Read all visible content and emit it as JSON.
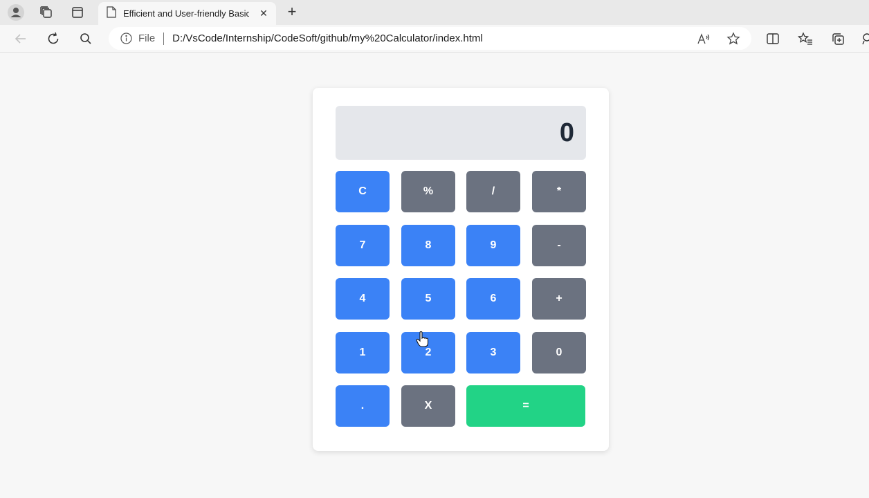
{
  "browser": {
    "tab_title": "Efficient and User-friendly Basic Calculator",
    "url_scheme_label": "File",
    "url": "D:/VsCode/Internship/CodeSoft/github/my%20Calculator/index.html"
  },
  "calculator": {
    "display_value": "0",
    "keys": {
      "clear": "C",
      "percent": "%",
      "divide": "/",
      "multiply": "*",
      "seven": "7",
      "eight": "8",
      "nine": "9",
      "minus": "-",
      "four": "4",
      "five": "5",
      "six": "6",
      "plus": "+",
      "one": "1",
      "two": "2",
      "three": "3",
      "zero": "0",
      "decimal": ".",
      "backspace": "X",
      "equals": "="
    },
    "colors": {
      "number_key": "#3b82f6",
      "operator_key": "#6b7280",
      "equals_key": "#22d386",
      "display_bg": "#e5e7eb"
    }
  }
}
